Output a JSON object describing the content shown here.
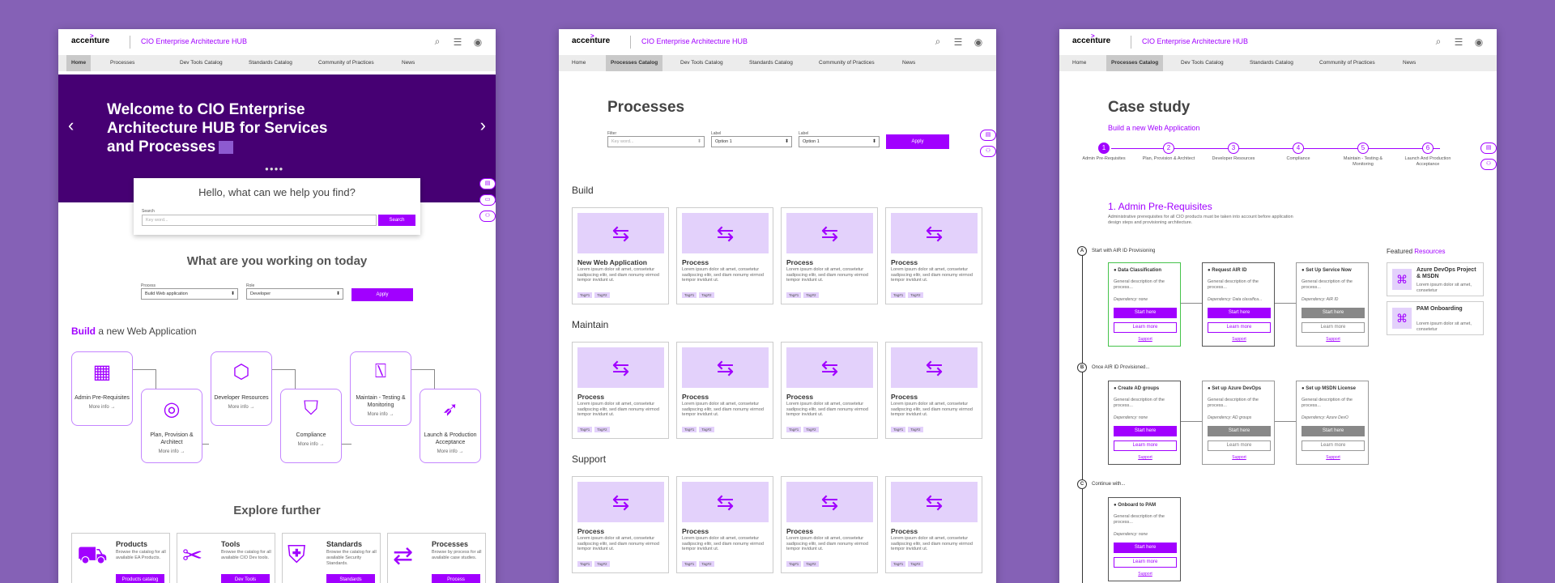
{
  "brand": {
    "logo": "accenture",
    "logo_accent": ">",
    "hub_title": "CIO Enterprise Architecture HUB",
    "accent": "#a100ff",
    "dark": "#460073"
  },
  "header_icons": [
    "search-icon",
    "menu-icon",
    "user-icon"
  ],
  "nav": [
    "Home",
    "Processes",
    "Dev Tools Catalog",
    "Standards Catalog",
    "Community of Practices",
    "News"
  ],
  "nav2": [
    "Home",
    "Processes Catalog",
    "Dev Tools Catalog",
    "Standards Catalog",
    "Community of Practices",
    "News"
  ],
  "home": {
    "hero_title": "Welcome to CIO Enterprise Architecture HUB for Services and Processes",
    "dots": "●●●●",
    "search_question": "Hello, what can we help you find?",
    "search_label": "Search",
    "search_placeholder": "Key word...",
    "search_button": "Search",
    "working_title": "What are you working on today",
    "process_label": "Process",
    "process_value": "Build Web application",
    "role_label": "Role",
    "role_value": "Developer",
    "apply": "Apply",
    "build_bold": "Build",
    "build_rest": " a new Web Application",
    "steps": [
      {
        "title": "Admin Pre-Requisites",
        "more": "More info →"
      },
      {
        "title": "Plan, Provision & Architect",
        "more": "More info →"
      },
      {
        "title": "Developer Resources",
        "more": "More info →"
      },
      {
        "title": "Compliance",
        "more": "More info →"
      },
      {
        "title": "Maintain - Testing & Monitoring",
        "more": "More info →"
      },
      {
        "title": "Launch & Production Acceptance",
        "more": "More info →"
      }
    ],
    "explore_title": "Explore further",
    "explore": [
      {
        "title": "Products",
        "desc": "Browse the catalog for all available EA Products.",
        "button": "Products catalog"
      },
      {
        "title": "Tools",
        "desc": "Browse the catalog for all available CIO Dev tools.",
        "button": "Dev Tools"
      },
      {
        "title": "Standards",
        "desc": "Browse the catalog for all available Security Standards.",
        "button": "Standards"
      },
      {
        "title": "Processes",
        "desc": "Browse by process for all available case studies.",
        "button": "Process"
      }
    ]
  },
  "catalog": {
    "title": "Processes",
    "filter_label": "Filter",
    "filter_placeholder": "Key word...",
    "label1": "Label",
    "label2": "Label",
    "opt1": "Option 1",
    "opt2": "Option 1",
    "apply": "Apply",
    "sections": [
      "Build",
      "Maintain",
      "Support"
    ],
    "first_card_title": "New Web Application",
    "card_title": "Process",
    "card_desc": "Lorem ipsum dolor sit amet, consetetur sadipscing elitr, sed diam nonumy eirmod tempor invidunt ut.",
    "tag1": "Tag#1",
    "tag2": "Tag#2"
  },
  "case": {
    "title": "Case study",
    "subtitle": "Build a new Web Application",
    "progress": [
      {
        "n": "1",
        "label": "Admin Pre-Requisites"
      },
      {
        "n": "2",
        "label": "Plan, Provision & Architect"
      },
      {
        "n": "3",
        "label": "Developer Resources"
      },
      {
        "n": "4",
        "label": "Compliance"
      },
      {
        "n": "5",
        "label": "Maintain - Testing & Monitoring"
      },
      {
        "n": "6",
        "label": "Launch And Production Acceptance"
      }
    ],
    "section_title": "1. Admin Pre-Requisites",
    "section_desc": "Administrative prerequisites for all CIO products must be taken into account before application design steps and provisioning architecture.",
    "markers": [
      {
        "id": "A",
        "text": "Start with AIR ID Provisioning"
      },
      {
        "id": "B",
        "text": "Once AIR ID Provisioned..."
      },
      {
        "id": "C",
        "text": "Continue with..."
      }
    ],
    "tasks": [
      {
        "title": "Data Classification",
        "desc": "General description of the process...",
        "dep": "Dependency: none",
        "start": "Start here",
        "learn": "Learn more",
        "support": "Support"
      },
      {
        "title": "Request AIR ID",
        "desc": "General description of the process...",
        "dep": "Dependency: Data classifica...",
        "start": "Start here",
        "learn": "Learn more",
        "support": "Support"
      },
      {
        "title": "Set Up Service Now",
        "desc": "General description of the process...",
        "dep": "Dependency: AIR ID",
        "start": "Start here",
        "learn": "Learn more",
        "support": "Support"
      },
      {
        "title": "Create AD groups",
        "desc": "General description of the process...",
        "dep": "Dependency: none",
        "start": "Start here",
        "learn": "Learn more",
        "support": "Support"
      },
      {
        "title": "Set up Azure DevOps",
        "desc": "General description of the process...",
        "dep": "Dependency: AD groups",
        "start": "Start here",
        "learn": "Learn more",
        "support": "Support"
      },
      {
        "title": "Set up MSDN License",
        "desc": "General description of the process...",
        "dep": "Dependency: Azure DevO",
        "start": "Start here",
        "learn": "Learn more",
        "support": "Support"
      },
      {
        "title": "Onboard to PAM",
        "desc": "General description of the process...",
        "dep": "Dependency: none",
        "start": "Start here",
        "learn": "Learn more",
        "support": "Support"
      }
    ],
    "featured_plain": "Featured ",
    "featured_accent": "Resources",
    "resources": [
      {
        "title": "Azure DevOps Project & MSDN",
        "desc": "Lorem ipsum dolor sit amet, consetetur"
      },
      {
        "title": "PAM Onboarding",
        "desc": "Lorem ipsum dolor sit amet, consetetur"
      }
    ]
  }
}
